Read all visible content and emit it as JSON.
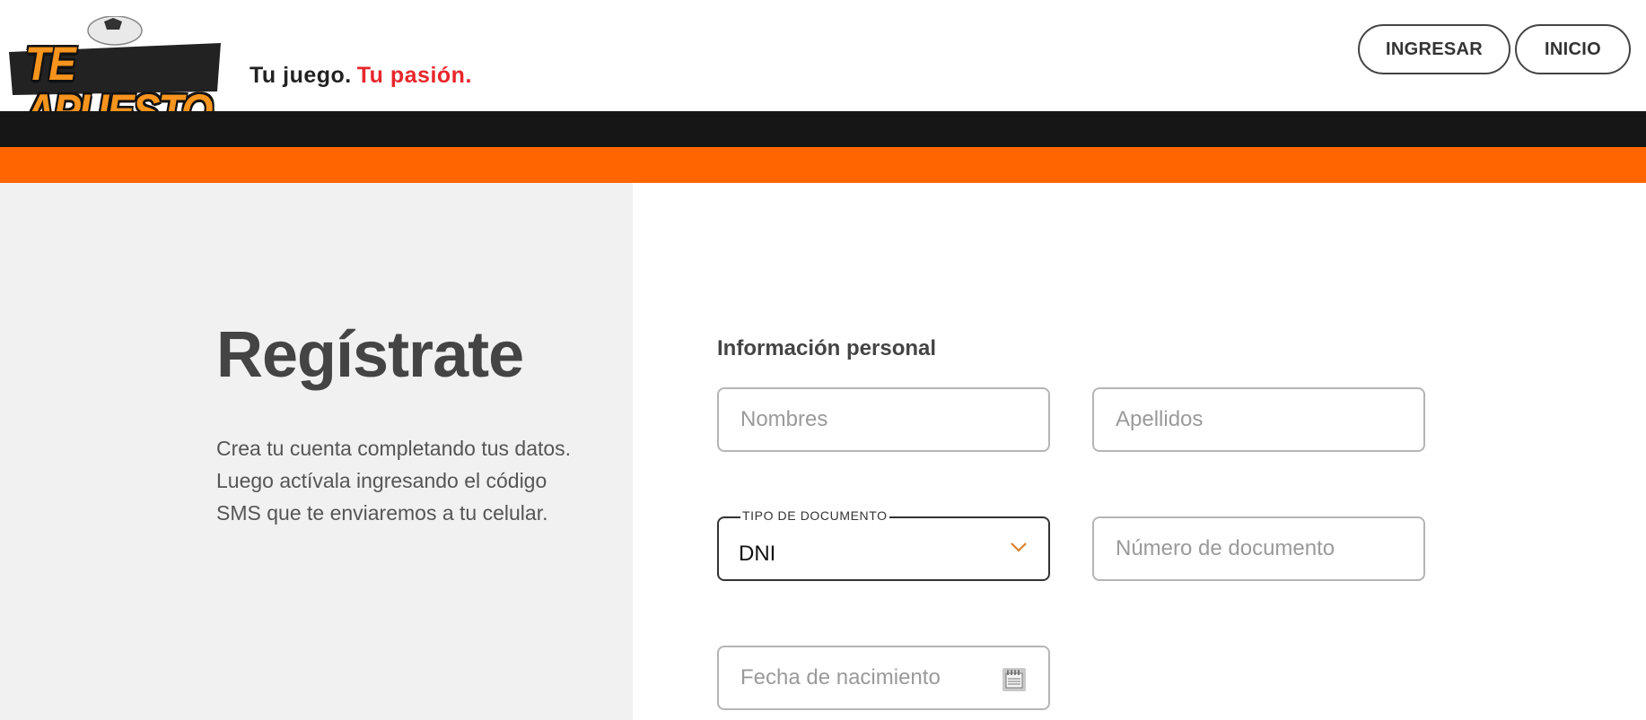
{
  "brand": {
    "logo_text": "TE APUESTO",
    "tagline_part1": "Tu juego.",
    "tagline_part2": "Tu pasión."
  },
  "nav": {
    "login_label": "INGRESAR",
    "home_label": "INICIO"
  },
  "intro": {
    "title": "Regístrate",
    "description": "Crea tu cuenta completando tus datos. Luego actívala ingresando el código SMS que te enviaremos a tu celular."
  },
  "form": {
    "section_title": "Información personal",
    "first_name": {
      "placeholder": "Nombres",
      "value": ""
    },
    "last_name": {
      "placeholder": "Apellidos",
      "value": ""
    },
    "document_type": {
      "label": "TIPO DE DOCUMENTO",
      "value": "DNI"
    },
    "document_number": {
      "placeholder": "Número de documento",
      "value": ""
    },
    "birth_date": {
      "placeholder": "Fecha de nacimiento",
      "value": ""
    }
  },
  "colors": {
    "accent_orange": "#ff6600",
    "band_black": "#161616",
    "tagline_red": "#e8262b",
    "logo_orange": "#f7941d",
    "left_panel_bg": "#f1f1f1"
  },
  "icons": [
    "soccer-ball-icon",
    "chevron-down-icon",
    "calendar-icon"
  ]
}
